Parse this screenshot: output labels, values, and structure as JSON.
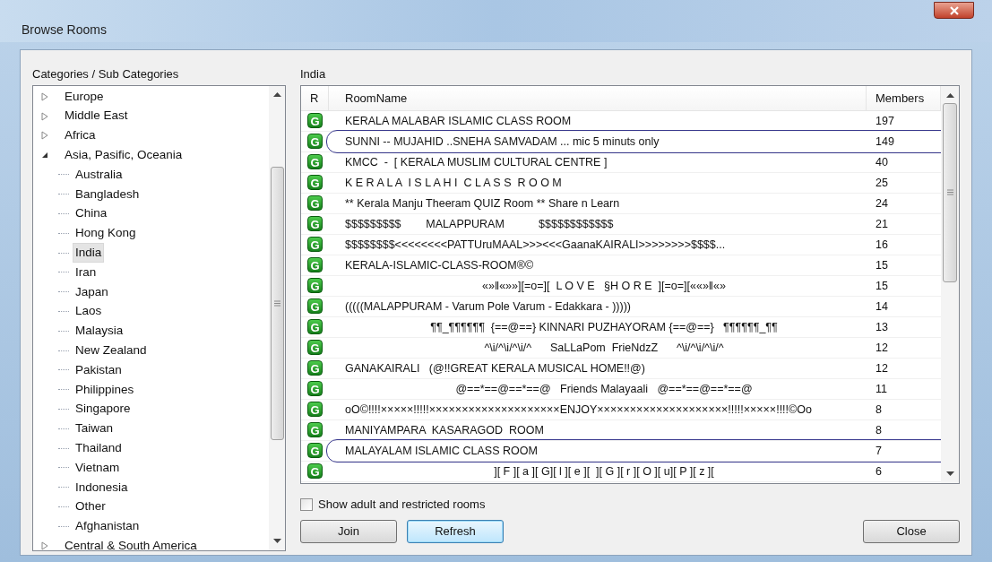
{
  "window": {
    "title": "Browse Rooms"
  },
  "categories": {
    "label": "Categories / Sub Categories",
    "items": [
      {
        "label": "Europe",
        "expanded": false,
        "selected": false
      },
      {
        "label": "Middle East",
        "expanded": false,
        "selected": false
      },
      {
        "label": "Africa",
        "expanded": false,
        "selected": false
      },
      {
        "label": "Asia, Pasific, Oceania",
        "expanded": true,
        "selected": false,
        "children": [
          {
            "label": "Australia",
            "selected": false
          },
          {
            "label": "Bangladesh",
            "selected": false
          },
          {
            "label": "China",
            "selected": false
          },
          {
            "label": "Hong Kong",
            "selected": false
          },
          {
            "label": "India",
            "selected": true
          },
          {
            "label": "Iran",
            "selected": false
          },
          {
            "label": "Japan",
            "selected": false
          },
          {
            "label": "Laos",
            "selected": false
          },
          {
            "label": "Malaysia",
            "selected": false
          },
          {
            "label": "New Zealand",
            "selected": false
          },
          {
            "label": "Pakistan",
            "selected": false
          },
          {
            "label": "Philippines",
            "selected": false
          },
          {
            "label": "Singapore",
            "selected": false
          },
          {
            "label": "Taiwan",
            "selected": false
          },
          {
            "label": "Thailand",
            "selected": false
          },
          {
            "label": "Vietnam",
            "selected": false
          },
          {
            "label": "Indonesia",
            "selected": false
          },
          {
            "label": "Other",
            "selected": false
          },
          {
            "label": "Afghanistan",
            "selected": false
          }
        ]
      },
      {
        "label": "Central & South America",
        "expanded": false,
        "selected": false
      }
    ]
  },
  "rooms": {
    "label": "India",
    "columns": [
      "R",
      "RoomName",
      "Members"
    ],
    "rows": [
      {
        "badge": "G",
        "name": "KERALA MALABAR ISLAMIC CLASS ROOM",
        "members": "197",
        "kind": "plain",
        "circled": false
      },
      {
        "badge": "G",
        "name": "SUNNI -- MUJAHID ..SNEHA SAMVADAM ... mic 5 minuts only",
        "members": "149",
        "kind": "plain",
        "circled": true
      },
      {
        "badge": "G",
        "name": "KMCC  -  [ KERALA MUSLIM CULTURAL CENTRE ]",
        "members": "40",
        "kind": "plain",
        "circled": false
      },
      {
        "badge": "G",
        "name": "K E R A L A  I S L A H I  C L A S S  R O O M",
        "members": "25",
        "kind": "plain",
        "circled": false
      },
      {
        "badge": "G",
        "name": "** Kerala Manju Theeram QUIZ Room ** Share n Learn",
        "members": "24",
        "kind": "plain",
        "circled": false
      },
      {
        "badge": "G",
        "name": "$$$$$$$$$        MALAPPURAM           $$$$$$$$$$$$",
        "members": "21",
        "kind": "plain",
        "circled": false
      },
      {
        "badge": "G",
        "name": "$$$$$$$$<<<<<<<<PATTUruMAAL>>><<<GaanaKAIRALI>>>>>>>>$$$$...",
        "members": "16",
        "kind": "plain",
        "circled": false
      },
      {
        "badge": "G",
        "name": "KERALA-ISLAMIC-CLASS-ROOM®©",
        "members": "15",
        "kind": "plain",
        "circled": false
      },
      {
        "badge": "G",
        "name": "«»‖«»»][=o=][  L O V E   §H O R E  ][=o=][««»‖«»",
        "members": "15",
        "kind": "centered",
        "circled": false
      },
      {
        "badge": "G",
        "name": "(((((MALAPPURAM - Varum Pole Varum - Edakkara - )))))",
        "members": "14",
        "kind": "plain",
        "circled": false
      },
      {
        "badge": "G",
        "name": "¶¶_¶¶¶¶¶¶  {==@==} KINNARI PUZHAYORAM {==@==}   ¶¶¶¶¶¶_¶¶",
        "members": "13",
        "kind": "centered",
        "circled": false
      },
      {
        "badge": "G",
        "name": "^\\i/^\\i/^\\i/^      SaLLaPom  FrieNdzZ      ^\\i/^\\i/^\\i/^",
        "members": "12",
        "kind": "centered",
        "circled": false
      },
      {
        "badge": "G",
        "name": "GANAKAIRALI   (@!!GREAT KERALA MUSICAL HOME!!@)",
        "members": "12",
        "kind": "plain",
        "circled": false
      },
      {
        "badge": "G",
        "name": "@==*==@==*==@   Friends Malayaali   @==*==@==*==@",
        "members": "11",
        "kind": "centered",
        "circled": false
      },
      {
        "badge": "G",
        "name": "oO©!!!!×××××!!!!!××××××××××××××××××××ENJOY××××××××××××××××××××!!!!!×××××!!!!©Oo",
        "members": "8",
        "kind": "plain",
        "circled": false
      },
      {
        "badge": "G",
        "name": "MANIYAMPARA  KASARAGOD  ROOM",
        "members": "8",
        "kind": "plain",
        "circled": false
      },
      {
        "badge": "G",
        "name": "MALAYALAM ISLAMIC CLASS ROOM",
        "members": "7",
        "kind": "plain",
        "circled": true
      },
      {
        "badge": "G",
        "name": "][ F ][ a ][ G][ l ][ e ][  ][ G ][ r ][ O ][ u][ P ][ z ][",
        "members": "6",
        "kind": "centered",
        "circled": false
      }
    ]
  },
  "show_adult": {
    "label": "Show adult and restricted rooms",
    "checked": false
  },
  "buttons": [
    {
      "label": "Join",
      "default": false
    },
    {
      "label": "Refresh",
      "default": true
    },
    {
      "label": "Close",
      "default": false
    }
  ]
}
